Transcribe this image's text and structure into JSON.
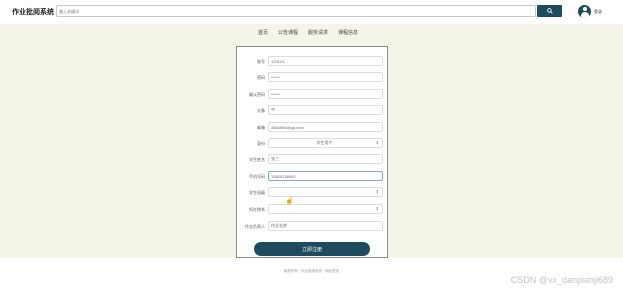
{
  "header": {
    "logo": "作业批阅系统",
    "search_placeholder": "输入关键词",
    "search_icon": "search-icon",
    "avatar_icon": "user-avatar-icon",
    "login_label": "登录"
  },
  "nav": {
    "items": [
      "首页",
      "公告课程",
      "服务请求",
      "课程信息"
    ]
  },
  "form": {
    "fields": [
      {
        "label": "账号",
        "value": "123123",
        "type": "text"
      },
      {
        "label": "密码",
        "value": "******",
        "type": "text"
      },
      {
        "label": "确认密码",
        "value": "******",
        "type": "text"
      },
      {
        "label": "头像",
        "value": "中",
        "type": "text"
      },
      {
        "label": "邮箱",
        "value": "4654656@qq.com",
        "type": "text"
      },
      {
        "label": "身份",
        "value": "学生用户",
        "type": "select"
      },
      {
        "label": "学生姓名",
        "value": "张三",
        "type": "text"
      },
      {
        "label": "手机号码",
        "value": "13800138000",
        "type": "text",
        "active": true
      },
      {
        "label": "学生班级",
        "value": "",
        "type": "select"
      },
      {
        "label": "所在院系",
        "value": "",
        "type": "select"
      },
      {
        "label": "作业负责人",
        "value": "作业名称",
        "type": "text"
      }
    ],
    "submit_label": "立即注册"
  },
  "footer": {
    "text": "版权所有 · 作业批阅系统 · 网站首页"
  },
  "watermark": "CSDN @vx_danpianji689",
  "colors": {
    "primary": "#1f4b5f",
    "band": "#f5f4e8"
  }
}
